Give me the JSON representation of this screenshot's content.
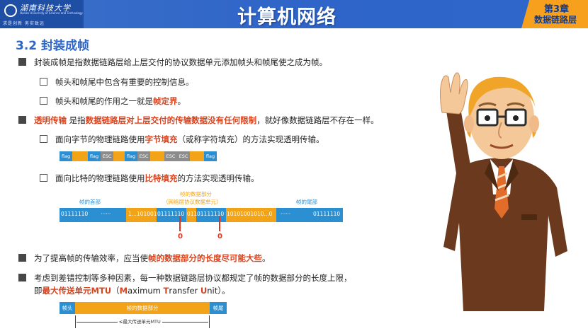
{
  "header": {
    "logo_name": "湖南科技大学",
    "logo_sub": "Hunan University of Science and Technology",
    "logo_motto": "求是创新  务实致远",
    "title": "计算机网络",
    "chapter_num": "第3章",
    "chapter_name": "数据链路层"
  },
  "section_title": "3.2 封装成帧",
  "p1": "封装成帧是指数据链路层给上层交付的协议数据单元添加帧头和帧尾使之成为帧。",
  "p1a": "帧头和帧尾中包含有重要的控制信息。",
  "p1b_pre": "帧头和帧尾的作用之一就是",
  "p1b_hl": "帧定界",
  "p1b_post": "。",
  "p2_hl1": "透明传输",
  "p2_mid": " 是指",
  "p2_hl2": "数据链路层对上层交付的传输数据没有任何限制",
  "p2_post": "，就好像数据链路层不存在一样。",
  "p2a_pre": "面向字节的物理链路使用",
  "p2a_hl": "字节填充",
  "p2a_post": "（或称字符填充）的方法实现透明传输。",
  "byte_frame": {
    "flag": "flag",
    "esc": "ESC"
  },
  "p2b_pre": "面向比特的物理链路使用",
  "p2b_hl": "比特填充",
  "p2b_post": "的方法实现透明传输。",
  "bit_frame": {
    "head_label": "帧的首部",
    "data_label1": "帧的数据部分",
    "data_label2": "（网络层协议数据单元）",
    "tail_label": "帧的尾部",
    "head_bits": "01111110",
    "dots": "······",
    "data_a": "1...101001",
    "data_b": "01111110",
    "data_c": "011",
    "data_d": "01111110",
    "data_e": "10101001010...0",
    "tail_bits": "01111110",
    "zero1": "0",
    "zero2": "0"
  },
  "p3_pre": "为了提高帧的传输效率，应当使",
  "p3_hl": "帧的数据部分的长度尽可能大些",
  "p3_post": "。",
  "p4_line1": "考虑到差错控制等多种因素，每一种数据链路层协议都规定了帧的数据部分的长度上限，",
  "p4_pre": "即",
  "p4_hl": "最大传送单元MTU",
  "p4_post1": "（",
  "p4_M": "M",
  "p4_aximum": "aximum ",
  "p4_T": "T",
  "p4_ransfer": "ransfer ",
  "p4_U": "U",
  "p4_nit": "nit",
  "p4_post2": "）。",
  "mtu_frame": {
    "head": "帧头",
    "data": "帧的数据部分",
    "tail": "帧尾",
    "mtu_label": "≤最大传送单元MTU"
  },
  "colors": {
    "blue": "#2c8fd1",
    "orange": "#f2a318",
    "highlight": "#d9431e",
    "header": "#2f65c8",
    "chapter": "#f6a01e"
  }
}
